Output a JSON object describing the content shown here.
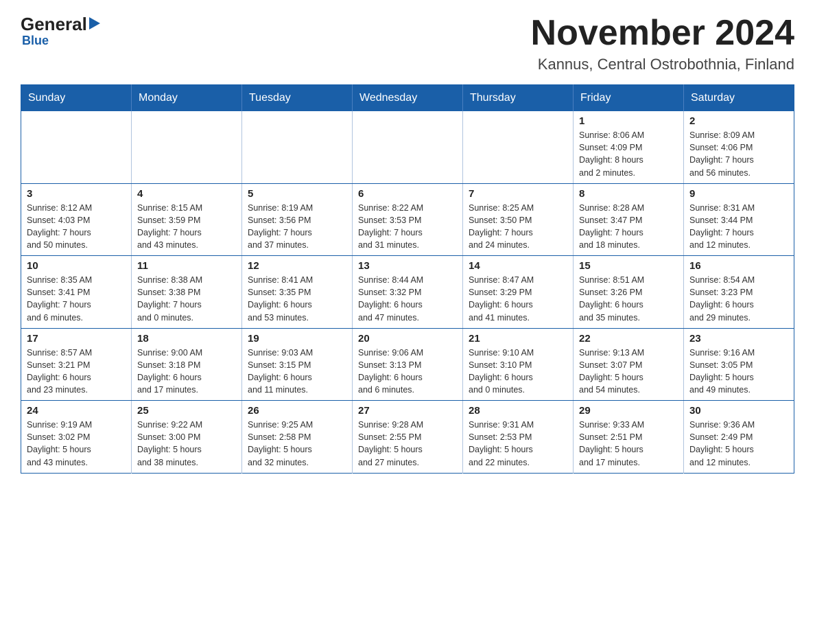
{
  "header": {
    "logo_general": "General",
    "logo_blue": "Blue",
    "month_title": "November 2024",
    "location": "Kannus, Central Ostrobothnia, Finland"
  },
  "weekdays": [
    "Sunday",
    "Monday",
    "Tuesday",
    "Wednesday",
    "Thursday",
    "Friday",
    "Saturday"
  ],
  "weeks": [
    [
      {
        "day": "",
        "info": ""
      },
      {
        "day": "",
        "info": ""
      },
      {
        "day": "",
        "info": ""
      },
      {
        "day": "",
        "info": ""
      },
      {
        "day": "",
        "info": ""
      },
      {
        "day": "1",
        "info": "Sunrise: 8:06 AM\nSunset: 4:09 PM\nDaylight: 8 hours\nand 2 minutes."
      },
      {
        "day": "2",
        "info": "Sunrise: 8:09 AM\nSunset: 4:06 PM\nDaylight: 7 hours\nand 56 minutes."
      }
    ],
    [
      {
        "day": "3",
        "info": "Sunrise: 8:12 AM\nSunset: 4:03 PM\nDaylight: 7 hours\nand 50 minutes."
      },
      {
        "day": "4",
        "info": "Sunrise: 8:15 AM\nSunset: 3:59 PM\nDaylight: 7 hours\nand 43 minutes."
      },
      {
        "day": "5",
        "info": "Sunrise: 8:19 AM\nSunset: 3:56 PM\nDaylight: 7 hours\nand 37 minutes."
      },
      {
        "day": "6",
        "info": "Sunrise: 8:22 AM\nSunset: 3:53 PM\nDaylight: 7 hours\nand 31 minutes."
      },
      {
        "day": "7",
        "info": "Sunrise: 8:25 AM\nSunset: 3:50 PM\nDaylight: 7 hours\nand 24 minutes."
      },
      {
        "day": "8",
        "info": "Sunrise: 8:28 AM\nSunset: 3:47 PM\nDaylight: 7 hours\nand 18 minutes."
      },
      {
        "day": "9",
        "info": "Sunrise: 8:31 AM\nSunset: 3:44 PM\nDaylight: 7 hours\nand 12 minutes."
      }
    ],
    [
      {
        "day": "10",
        "info": "Sunrise: 8:35 AM\nSunset: 3:41 PM\nDaylight: 7 hours\nand 6 minutes."
      },
      {
        "day": "11",
        "info": "Sunrise: 8:38 AM\nSunset: 3:38 PM\nDaylight: 7 hours\nand 0 minutes."
      },
      {
        "day": "12",
        "info": "Sunrise: 8:41 AM\nSunset: 3:35 PM\nDaylight: 6 hours\nand 53 minutes."
      },
      {
        "day": "13",
        "info": "Sunrise: 8:44 AM\nSunset: 3:32 PM\nDaylight: 6 hours\nand 47 minutes."
      },
      {
        "day": "14",
        "info": "Sunrise: 8:47 AM\nSunset: 3:29 PM\nDaylight: 6 hours\nand 41 minutes."
      },
      {
        "day": "15",
        "info": "Sunrise: 8:51 AM\nSunset: 3:26 PM\nDaylight: 6 hours\nand 35 minutes."
      },
      {
        "day": "16",
        "info": "Sunrise: 8:54 AM\nSunset: 3:23 PM\nDaylight: 6 hours\nand 29 minutes."
      }
    ],
    [
      {
        "day": "17",
        "info": "Sunrise: 8:57 AM\nSunset: 3:21 PM\nDaylight: 6 hours\nand 23 minutes."
      },
      {
        "day": "18",
        "info": "Sunrise: 9:00 AM\nSunset: 3:18 PM\nDaylight: 6 hours\nand 17 minutes."
      },
      {
        "day": "19",
        "info": "Sunrise: 9:03 AM\nSunset: 3:15 PM\nDaylight: 6 hours\nand 11 minutes."
      },
      {
        "day": "20",
        "info": "Sunrise: 9:06 AM\nSunset: 3:13 PM\nDaylight: 6 hours\nand 6 minutes."
      },
      {
        "day": "21",
        "info": "Sunrise: 9:10 AM\nSunset: 3:10 PM\nDaylight: 6 hours\nand 0 minutes."
      },
      {
        "day": "22",
        "info": "Sunrise: 9:13 AM\nSunset: 3:07 PM\nDaylight: 5 hours\nand 54 minutes."
      },
      {
        "day": "23",
        "info": "Sunrise: 9:16 AM\nSunset: 3:05 PM\nDaylight: 5 hours\nand 49 minutes."
      }
    ],
    [
      {
        "day": "24",
        "info": "Sunrise: 9:19 AM\nSunset: 3:02 PM\nDaylight: 5 hours\nand 43 minutes."
      },
      {
        "day": "25",
        "info": "Sunrise: 9:22 AM\nSunset: 3:00 PM\nDaylight: 5 hours\nand 38 minutes."
      },
      {
        "day": "26",
        "info": "Sunrise: 9:25 AM\nSunset: 2:58 PM\nDaylight: 5 hours\nand 32 minutes."
      },
      {
        "day": "27",
        "info": "Sunrise: 9:28 AM\nSunset: 2:55 PM\nDaylight: 5 hours\nand 27 minutes."
      },
      {
        "day": "28",
        "info": "Sunrise: 9:31 AM\nSunset: 2:53 PM\nDaylight: 5 hours\nand 22 minutes."
      },
      {
        "day": "29",
        "info": "Sunrise: 9:33 AM\nSunset: 2:51 PM\nDaylight: 5 hours\nand 17 minutes."
      },
      {
        "day": "30",
        "info": "Sunrise: 9:36 AM\nSunset: 2:49 PM\nDaylight: 5 hours\nand 12 minutes."
      }
    ]
  ]
}
